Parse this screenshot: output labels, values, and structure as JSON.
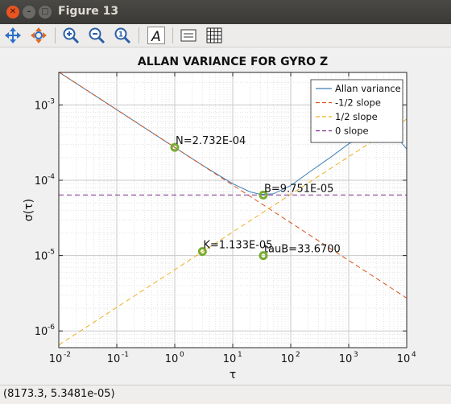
{
  "window": {
    "title": "Figure 13"
  },
  "toolbar": {
    "tools": [
      {
        "name": "pan-icon"
      },
      {
        "name": "rotate-icon"
      },
      {
        "name": "zoom-in-icon"
      },
      {
        "name": "zoom-out-icon"
      },
      {
        "name": "zoom-fit-icon"
      },
      {
        "name": "insert-text-icon"
      },
      {
        "name": "toggle-legend-icon"
      },
      {
        "name": "toggle-grid-icon"
      }
    ]
  },
  "status": {
    "text": "(8173.3, 5.3481e-05)"
  },
  "chart_data": {
    "type": "line",
    "title": "ALLAN VARIANCE FOR GYRO Z",
    "xlabel": "τ",
    "ylabel": "σ(τ)",
    "xscale": "log",
    "yscale": "log",
    "xlim": [
      0.01,
      10000
    ],
    "ylim": [
      6e-07,
      0.0027
    ],
    "xticks": [
      {
        "base": "10",
        "exp": "-2"
      },
      {
        "base": "10",
        "exp": "-1"
      },
      {
        "base": "10",
        "exp": "0"
      },
      {
        "base": "10",
        "exp": "1"
      },
      {
        "base": "10",
        "exp": "2"
      },
      {
        "base": "10",
        "exp": "3"
      },
      {
        "base": "10",
        "exp": "4"
      }
    ],
    "yticks": [
      {
        "base": "10",
        "exp": "-6"
      },
      {
        "base": "10",
        "exp": "-5"
      },
      {
        "base": "10",
        "exp": "-4"
      },
      {
        "base": "10",
        "exp": "-3"
      }
    ],
    "grid": true,
    "legend_position": "top-right",
    "series": [
      {
        "name": "Allan variance",
        "color": "#3d7fb9",
        "style": "solid",
        "x": [
          0.01,
          0.1,
          1,
          3,
          10,
          20,
          30,
          50,
          100,
          200,
          500,
          1000,
          2000,
          4000,
          6000,
          8000,
          10000
        ],
        "y": [
          0.00273,
          0.000864,
          0.000273,
          0.000158,
          9e-05,
          7e-05,
          6.5e-05,
          6.6e-05,
          8.5e-05,
          0.000125,
          0.000205,
          0.000305,
          0.0004,
          0.000475,
          0.00049,
          0.00032,
          0.00026
        ]
      },
      {
        "name": "-1/2 slope",
        "color": "#d95319",
        "style": "dashed",
        "x": [
          0.01,
          10000
        ],
        "y": [
          0.002732,
          2.732e-06
        ]
      },
      {
        "name": "1/2 slope",
        "color": "#edb120",
        "style": "dashed",
        "x": [
          0.01,
          10000
        ],
        "y": [
          6.5e-07,
          0.00065
        ]
      },
      {
        "name": "0 slope",
        "color": "#7e2f8e",
        "style": "dashed",
        "x": [
          0.01,
          10000
        ],
        "y": [
          6.37e-05,
          6.37e-05
        ]
      }
    ],
    "annotations": [
      {
        "text": "N=2.732E-04",
        "x": 1,
        "y": 0.0002732
      },
      {
        "text": "B=9.751E-05",
        "x": 33.67,
        "y": 6.37e-05
      },
      {
        "text": "K=1.133E-05",
        "x": 3,
        "y": 1.133e-05
      },
      {
        "text": "tauB=33.6700",
        "x": 33.67,
        "y": 1e-05
      }
    ],
    "marker_color": "#77ac30"
  }
}
